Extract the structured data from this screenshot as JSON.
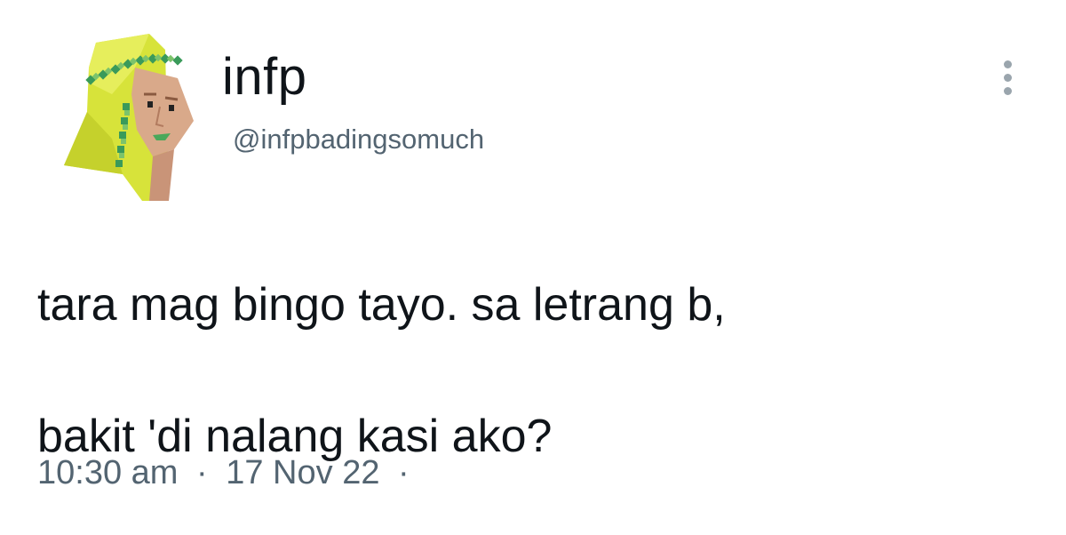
{
  "author": {
    "display_name": "infp",
    "handle": "@infpbadingsomuch",
    "avatar_icon": "pixel-art-figure-avatar"
  },
  "tweet": {
    "line1": "tara mag bingo tayo. sa letrang b,",
    "line2": "bakit 'di nalang kasi ako?"
  },
  "meta": {
    "time": "10:30 am",
    "separator": "·",
    "date": "17 Nov 22"
  },
  "menu": {
    "icon": "more-dots-vertical-icon"
  },
  "colors": {
    "text_primary": "#0f1419",
    "text_secondary": "#536471",
    "hood_yellow": "#d7e33a",
    "headband_green": "#3a9a5a",
    "skin": "#d9a98a"
  }
}
